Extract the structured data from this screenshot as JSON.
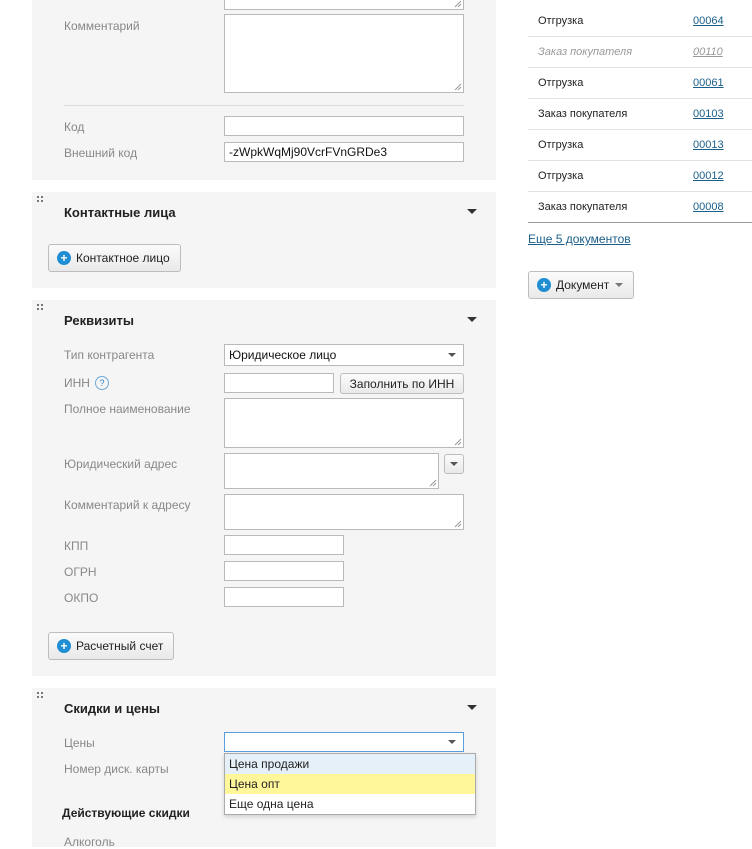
{
  "form": {
    "comment_label": "Комментарий",
    "code_label": "Код",
    "code_value": "",
    "ext_code_label": "Внешний код",
    "ext_code_value": "-zWpkWqMj90VcrFVnGRDe3"
  },
  "contacts": {
    "title": "Контактные лица",
    "add_button": "Контактное лицо"
  },
  "requisites": {
    "title": "Реквизиты",
    "type_label": "Тип контрагента",
    "type_value": "Юридическое лицо",
    "inn_label": "ИНН",
    "inn_help": "?",
    "inn_value": "",
    "fill_by_inn_button": "Заполнить по ИНН",
    "full_name_label": "Полное наименование",
    "legal_address_label": "Юридический адрес",
    "address_comment_label": "Комментарий к адресу",
    "kpp_label": "КПП",
    "ogrn_label": "ОГРН",
    "okpo_label": "ОКПО",
    "add_account_button": "Расчетный счет"
  },
  "discounts": {
    "title": "Скидки и цены",
    "prices_label": "Цены",
    "prices_value": "",
    "card_label": "Номер диск. карты",
    "active_discounts_title": "Действующие скидки",
    "alcohol_label": "Алкоголь",
    "price_options": [
      "Цена продажи",
      "Цена опт",
      "Еще одна цена"
    ]
  },
  "documents": {
    "rows": [
      {
        "type": "Отгрузка",
        "number": "00064",
        "muted": false
      },
      {
        "type": "Заказ покупателя",
        "number": "00110",
        "muted": true
      },
      {
        "type": "Отгрузка",
        "number": "00061",
        "muted": false
      },
      {
        "type": "Заказ покупателя",
        "number": "00103",
        "muted": false
      },
      {
        "type": "Отгрузка",
        "number": "00013",
        "muted": false
      },
      {
        "type": "Отгрузка",
        "number": "00012",
        "muted": false
      },
      {
        "type": "Заказ покупателя",
        "number": "00008",
        "muted": false
      }
    ],
    "more_link": "Еще 5 документов",
    "add_button": "Документ"
  },
  "colors": {
    "accent": "#1f8ed2",
    "link": "#1a5e8a",
    "panel_bg": "#f5f5f5",
    "highlight": "#fff799",
    "hover": "#e6f0f8"
  }
}
